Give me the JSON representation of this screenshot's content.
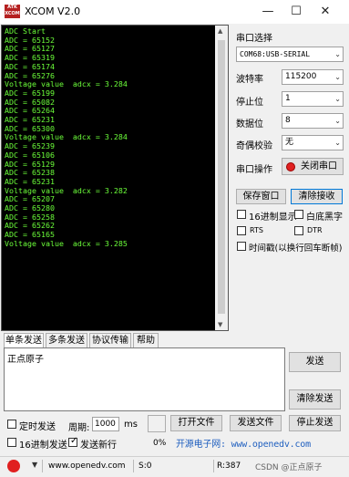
{
  "window": {
    "title": "XCOM V2.0",
    "logo_text": "ATK XCOM"
  },
  "terminal_text": "ADC Start\nADC = 65152\nADC = 65127\nADC = 65319\nADC = 65174\nADC = 65276\nVoltage value  adcx = 3.284\nADC = 65199\nADC = 65082\nADC = 65264\nADC = 65231\nADC = 65300\nVoltage value  adcx = 3.284\nADC = 65239\nADC = 65106\nADC = 65129\nADC = 65238\nADC = 65231\nVoltage value  adcx = 3.282\nADC = 65207\nADC = 65280\nADC = 65258\nADC = 65262\nADC = 65165\nVoltage value  adcx = 3.285",
  "settings": {
    "port_label": "串口选择",
    "port_value": "COM68:USB-SERIAL",
    "baud_label": "波特率",
    "baud_value": "115200",
    "stop_label": "停止位",
    "stop_value": "1",
    "data_label": "数据位",
    "data_value": "8",
    "parity_label": "奇偶校验",
    "parity_value": "无",
    "op_label": "串口操作",
    "close_port_label": "关闭串口",
    "save_window_label": "保存窗口",
    "clear_receive_label": "清除接收",
    "hex_display_label": "16进制显示",
    "white_bg_label": "白底黑字",
    "rts_label": "RTS",
    "dtr_label": "DTR",
    "timestamp_label": "时间戳(以换行回车断帧)"
  },
  "tabs": [
    "单条发送",
    "多条发送",
    "协议传输",
    "帮助"
  ],
  "send": {
    "text": "正点原子",
    "send_label": "发送",
    "clear_send_label": "清除发送",
    "timed_send_label": "定时发送",
    "period_label": "周期:",
    "period_value": "1000",
    "ms_label": "ms",
    "open_file_label": "打开文件",
    "send_file_label": "发送文件",
    "stop_send_label": "停止发送",
    "hex_send_label": "16进制发送",
    "send_newline_label": "发送新行",
    "progress_label": "0%",
    "link_text": "开源电子网: www.openedv.com"
  },
  "status": {
    "url": "www.openedv.com",
    "s_count": "S:0",
    "r_count": "R:387",
    "watermark": "CSDN @正点原子"
  },
  "colors": {
    "terminal_bg": "#000000",
    "terminal_fg": "#6cff3a",
    "link_blue": "#1f5fbf",
    "logo_red": "#b52020"
  }
}
